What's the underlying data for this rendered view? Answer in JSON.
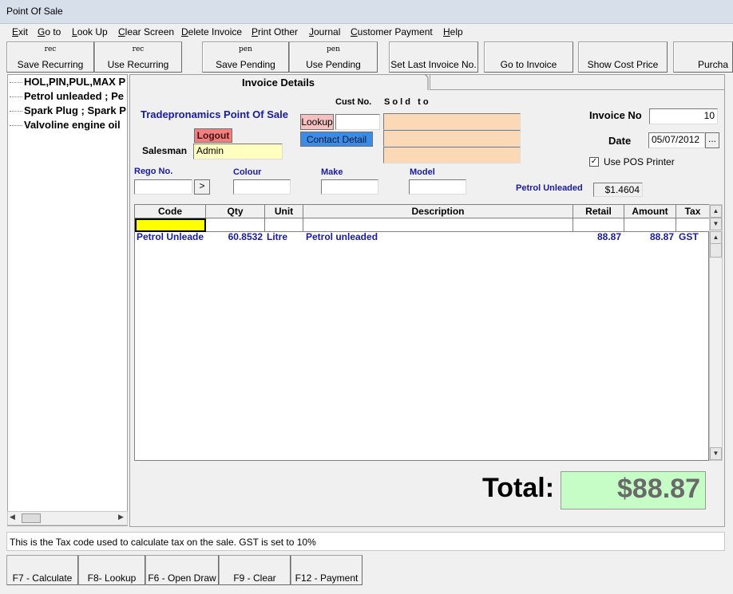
{
  "window": {
    "title": "Point Of Sale"
  },
  "menu": [
    "Exit",
    "Go to",
    "Look Up",
    "Clear Screen",
    "Delete Invoice",
    "Print Other",
    "Journal",
    "Customer Payment",
    "Help"
  ],
  "toolbar": {
    "save_recurring": {
      "icon": "rec",
      "label": "Save Recurring"
    },
    "use_recurring": {
      "icon": "rec",
      "label": "Use Recurring"
    },
    "save_pending": {
      "icon": "pen",
      "label": "Save Pending"
    },
    "use_pending": {
      "icon": "pen",
      "label": "Use Pending"
    },
    "set_last_invoice": "Set Last Invoice No.",
    "go_to_invoice": "Go to Invoice",
    "show_cost_price": "Show Cost Price",
    "purchase": "Purcha"
  },
  "tree": [
    "HOL,PIN,PUL,MAX P",
    "Petrol unleaded ; Pe",
    "Spark Plug ; Spark P",
    "Valvoline engine oil"
  ],
  "tab": "Invoice Details",
  "form": {
    "company": "Tradepronamics Point Of Sale",
    "logout": "Logout",
    "salesman_label": "Salesman",
    "salesman_value": "Admin",
    "cust_no_label": "Cust No.",
    "sold_to_label": "S o l d   t o",
    "lookup": "Lookup",
    "contact_detail": "Contact Detail",
    "invoice_no_label": "Invoice No",
    "invoice_no": "10",
    "date_label": "Date",
    "date": "05/07/2012",
    "date_btn": "...",
    "use_pos_printer": "Use POS Printer",
    "use_pos_checked": true,
    "rego_label": "Rego No.",
    "rego_btn": ">",
    "colour_label": "Colour",
    "make_label": "Make",
    "model_label": "Model",
    "fuel_label": "Petrol Unleaded",
    "fuel_price": "$1.4604"
  },
  "grid": {
    "columns": [
      "Code",
      "Qty",
      "Unit",
      "Description",
      "Retail",
      "Amount",
      "Tax"
    ],
    "rows": [
      {
        "code": "Petrol Unleade",
        "qty": "60.8532",
        "unit": "Litre",
        "description": "Petrol unleaded",
        "retail": "88.87",
        "amount": "88.87",
        "tax": "GST"
      }
    ]
  },
  "total": {
    "label": "Total:",
    "value": "$88.87"
  },
  "status": "This is the Tax code used to calculate tax on the sale. GST is set to 10%",
  "fkeys": [
    "F7 - Calculate",
    "F8- Lookup",
    "F6 - Open Draw",
    "F9 - Clear",
    "F12 - Payment"
  ],
  "colors": {
    "accent_blue": "#1a1a9e",
    "sold_to_bg": "#fcd9b6",
    "total_bg": "#c6fcc6",
    "code_cell_bg": "#ffff00",
    "salesman_bg": "#ffffc0",
    "logout_bg": "#f08080",
    "contact_bg": "#3c8ce6"
  }
}
